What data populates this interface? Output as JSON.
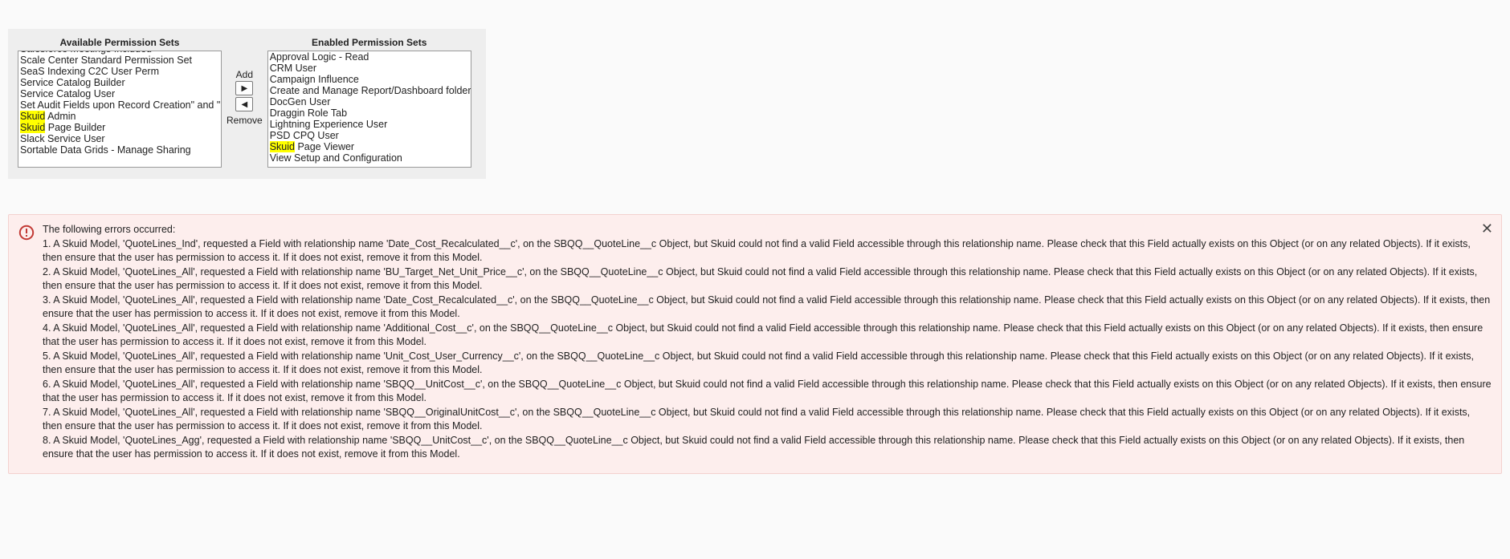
{
  "permissions": {
    "available_header": "Available Permission Sets",
    "enabled_header": "Enabled Permission Sets",
    "add_label": "Add",
    "remove_label": "Remove",
    "available": [
      "Salesforce Meetings Included",
      "Scale Center Standard Permission Set",
      "SeaS Indexing C2C User Perm",
      "Service Catalog Builder",
      "Service Catalog User",
      "Set Audit Fields upon Record Creation\" and \"Up",
      "Skuid Admin",
      "Skuid Page Builder",
      "Slack Service User",
      "Sortable Data Grids - Manage Sharing"
    ],
    "available_highlight_prefixes": {
      "6": "Skuid",
      "7": "Skuid"
    },
    "enabled": [
      "Approval Logic - Read",
      "CRM User",
      "Campaign Influence",
      "Create and Manage Report/Dashboard folders",
      "DocGen User",
      "Draggin Role Tab",
      "Lightning Experience User",
      "PSD CPQ User",
      "Skuid Page Viewer",
      "View Setup and Configuration"
    ],
    "enabled_highlight_prefixes": {
      "8": "Skuid"
    }
  },
  "errors": {
    "title": "The following errors occurred:",
    "items": [
      "1. A Skuid Model, 'QuoteLines_Ind', requested a Field with relationship name 'Date_Cost_Recalculated__c', on the SBQQ__QuoteLine__c Object, but Skuid could not find a valid Field accessible through this relationship name. Please check that this Field actually exists on this Object (or on any related Objects). If it exists, then ensure that the user has permission to access it. If it does not exist, remove it from this Model.",
      "2. A Skuid Model, 'QuoteLines_All', requested a Field with relationship name 'BU_Target_Net_Unit_Price__c', on the SBQQ__QuoteLine__c Object, but Skuid could not find a valid Field accessible through this relationship name. Please check that this Field actually exists on this Object (or on any related Objects). If it exists, then ensure that the user has permission to access it. If it does not exist, remove it from this Model.",
      "3. A Skuid Model, 'QuoteLines_All', requested a Field with relationship name 'Date_Cost_Recalculated__c', on the SBQQ__QuoteLine__c Object, but Skuid could not find a valid Field accessible through this relationship name. Please check that this Field actually exists on this Object (or on any related Objects). If it exists, then ensure that the user has permission to access it. If it does not exist, remove it from this Model.",
      "4. A Skuid Model, 'QuoteLines_All', requested a Field with relationship name 'Additional_Cost__c', on the SBQQ__QuoteLine__c Object, but Skuid could not find a valid Field accessible through this relationship name. Please check that this Field actually exists on this Object (or on any related Objects). If it exists, then ensure that the user has permission to access it. If it does not exist, remove it from this Model.",
      "5. A Skuid Model, 'QuoteLines_All', requested a Field with relationship name 'Unit_Cost_User_Currency__c', on the SBQQ__QuoteLine__c Object, but Skuid could not find a valid Field accessible through this relationship name. Please check that this Field actually exists on this Object (or on any related Objects). If it exists, then ensure that the user has permission to access it. If it does not exist, remove it from this Model.",
      "6. A Skuid Model, 'QuoteLines_All', requested a Field with relationship name 'SBQQ__UnitCost__c', on the SBQQ__QuoteLine__c Object, but Skuid could not find a valid Field accessible through this relationship name. Please check that this Field actually exists on this Object (or on any related Objects). If it exists, then ensure that the user has permission to access it. If it does not exist, remove it from this Model.",
      "7. A Skuid Model, 'QuoteLines_All', requested a Field with relationship name 'SBQQ__OriginalUnitCost__c', on the SBQQ__QuoteLine__c Object, but Skuid could not find a valid Field accessible through this relationship name. Please check that this Field actually exists on this Object (or on any related Objects). If it exists, then ensure that the user has permission to access it. If it does not exist, remove it from this Model.",
      "8. A Skuid Model, 'QuoteLines_Agg', requested a Field with relationship name 'SBQQ__UnitCost__c', on the SBQQ__QuoteLine__c Object, but Skuid could not find a valid Field accessible through this relationship name. Please check that this Field actually exists on this Object (or on any related Objects). If it exists, then ensure that the user has permission to access it. If it does not exist, remove it from this Model."
    ]
  }
}
